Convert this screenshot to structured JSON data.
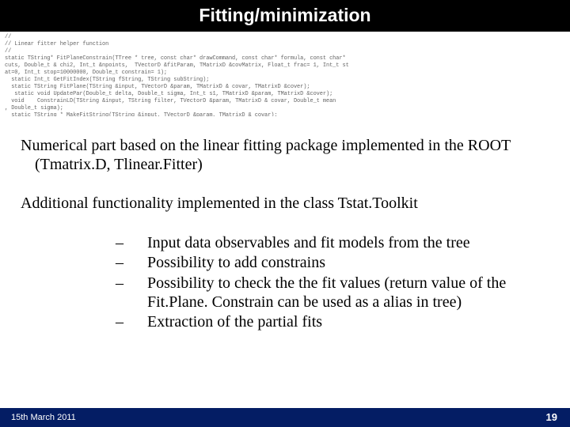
{
  "title": "Fitting/minimization",
  "code": "//\n// Linear fitter helper function\n//\nstatic TString* FitPlaneConstrain(TTree * tree, const char* drawCommand, const char* formula, const char*\ncuts, Double_t & chi2, Int_t &npoints,  TVectorD &fitParam, TMatrixD &covMatrix, Float_t frac= 1, Int_t st\nat=0, Int_t stop=10000000, Double_t constrain= 1);\n  static Int_t GetFitIndex(TString fString, TString subString);\n  static TString FitPlane(TString &input, TVectorD &param, TMatrixD & covar, TMatrixD &cover);\n   static void UpdatePar(Double_t delta, Double_t sigma, Int_t s1, TMatrixD &param, TMatrixD &cover);\n  void    ConstrainLD(TString &input, TString filter, TVectorD &param, TMatrixD & covar, Double_t mean\n, Double_t sigma);\n  static TString * MakeFitString(TString &input, TVectorD &param, TMatrixD & covar);",
  "para1": "Numerical part based on the linear fitting package implemented in the ROOT (Tmatrix.D, Tlinear.Fitter)",
  "para2": "Additional functionality implemented in the class Tstat.Toolkit",
  "bullets": [
    "Input data  observables and fit models from the tree",
    "Possibility to add constrains",
    "Possibility to check the the fit values (return value of the Fit.Plane. Constrain can be used as a alias in tree)",
    "Extraction of the partial fits"
  ],
  "footer": {
    "date_ord": "15th",
    "date_rest": " March 2011",
    "page": "19"
  }
}
